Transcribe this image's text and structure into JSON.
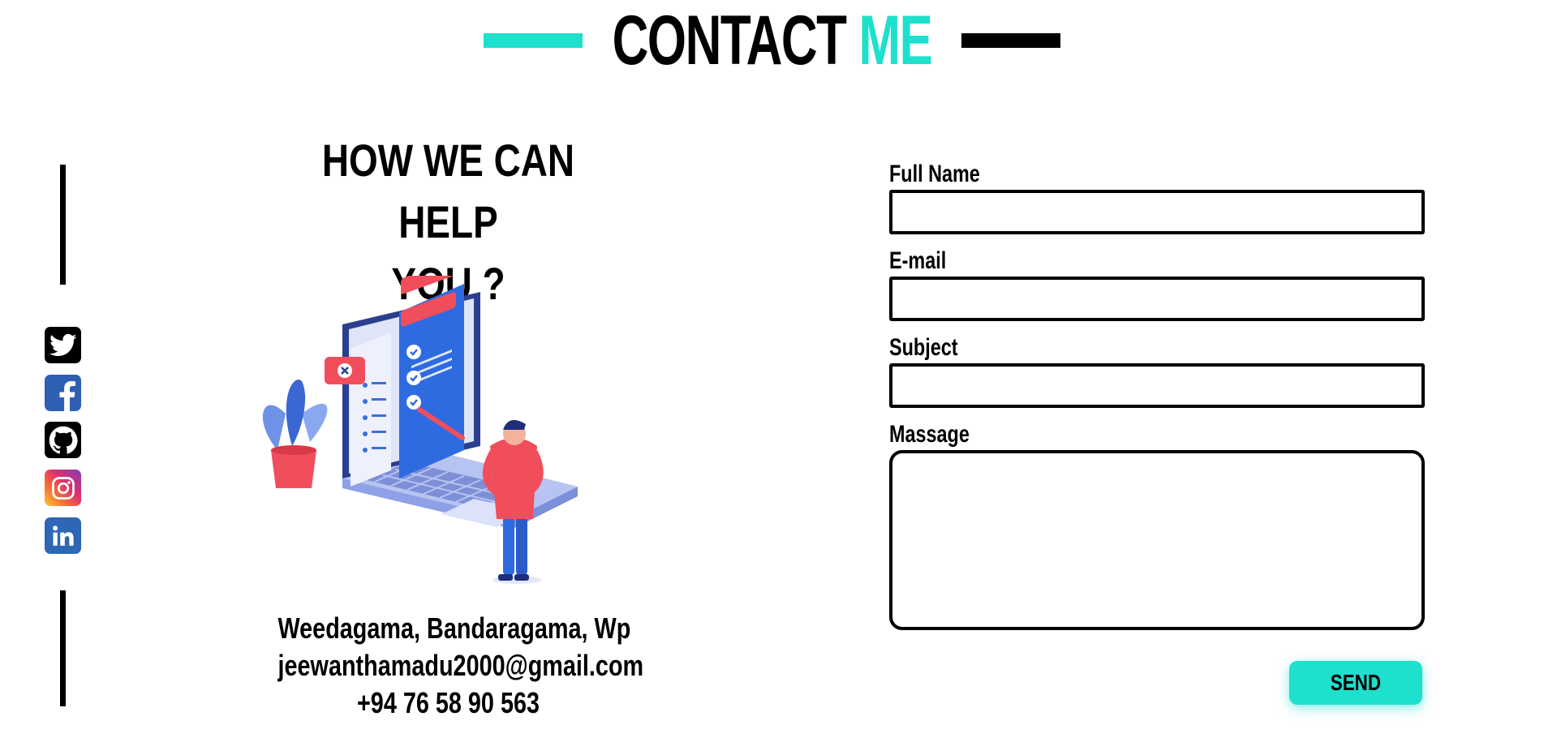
{
  "title": {
    "word1": "CONTACT",
    "word2": "ME",
    "accent_color": "#1de0cd",
    "dark_color": "#000000"
  },
  "social": {
    "icons": [
      "twitter-icon",
      "facebook-icon",
      "github-icon",
      "instagram-icon",
      "linkedin-icon"
    ]
  },
  "help": {
    "heading_line1": "HOW WE CAN HELP",
    "heading_line2": "YOU ?",
    "illustration": "person-with-laptop-checklist-illustration"
  },
  "contact": {
    "address": "Weedagama, Bandaragama, Wp",
    "email": "jeewanthamadu2000@gmail.com",
    "phone": "+94 76 58 90 563"
  },
  "form": {
    "full_name_label": "Full Name",
    "full_name_value": "",
    "email_label": "E-mail",
    "email_value": "",
    "subject_label": "Subject",
    "subject_value": "",
    "message_label": "Massage",
    "message_value": "",
    "send_label": "SEND"
  }
}
